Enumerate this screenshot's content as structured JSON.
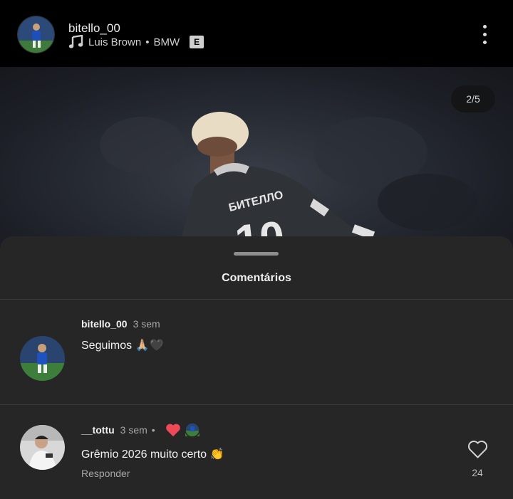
{
  "header": {
    "username": "bitello_00",
    "audio_artist": "Luis Brown",
    "audio_sep": "•",
    "audio_title": "BMW",
    "explicit_badge": "E"
  },
  "photo": {
    "counter": "2/5",
    "jersey_name": "БИТЕЛЛО",
    "jersey_number": "10"
  },
  "sheet": {
    "title": "Comentários"
  },
  "comments": [
    {
      "username": "bitello_00",
      "time": "3 sem",
      "text": "Seguimos 🙏🏼🖤"
    },
    {
      "username": "__tottu",
      "time": "3 sem",
      "bullet": "•",
      "text": "Grêmio 2026 muito certo 👏",
      "reply_label": "Responder",
      "like_count": "24"
    }
  ],
  "colors": {
    "background": "#000000",
    "sheet": "#262626",
    "heart_red": "#ed4956",
    "muted_text": "#a8a8a8"
  }
}
